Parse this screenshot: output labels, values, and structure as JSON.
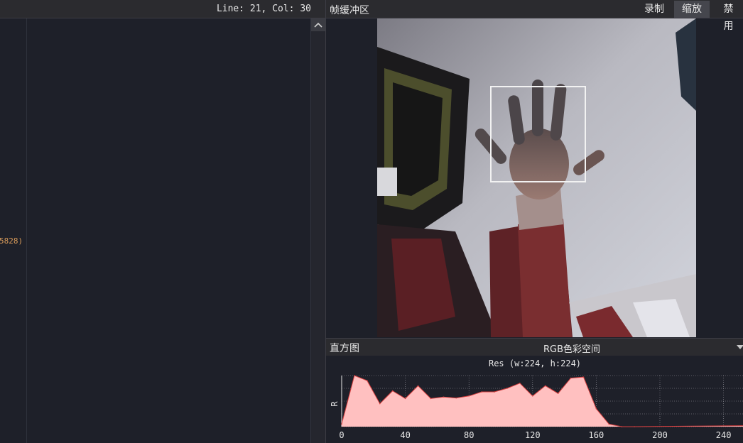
{
  "editor": {
    "cursor_position": "Line: 21, Col: 30",
    "code_fragment": "5828)"
  },
  "frame_buffer": {
    "title": "帧缓冲区",
    "buttons": {
      "record": "录制",
      "zoom": "缩放",
      "disable": "禁用"
    },
    "active_button": "zoom"
  },
  "histogram": {
    "title": "直方图",
    "colorspace": "RGB色彩空间",
    "resolution_label": "Res (w:224, h:224)",
    "fill_color": "#ffc0c0",
    "line_color": "#d84040",
    "chart_data": {
      "type": "area",
      "title": "",
      "ylabel": "R",
      "xlabel": "",
      "xlim": [
        0,
        255
      ],
      "ylim": [
        0,
        1
      ],
      "ticks": [
        "0",
        "40",
        "80",
        "120",
        "160",
        "200",
        "240"
      ],
      "x": [
        0,
        8,
        16,
        24,
        32,
        40,
        48,
        56,
        64,
        72,
        80,
        88,
        96,
        104,
        112,
        120,
        128,
        136,
        144,
        152,
        160,
        168,
        176,
        184,
        255
      ],
      "series": [
        {
          "values": [
            0.05,
            1.0,
            0.9,
            0.45,
            0.7,
            0.55,
            0.8,
            0.55,
            0.58,
            0.56,
            0.6,
            0.68,
            0.68,
            0.75,
            0.85,
            0.6,
            0.8,
            0.65,
            0.95,
            0.97,
            0.35,
            0.05,
            0.0,
            0.0,
            0.02
          ]
        }
      ]
    }
  }
}
